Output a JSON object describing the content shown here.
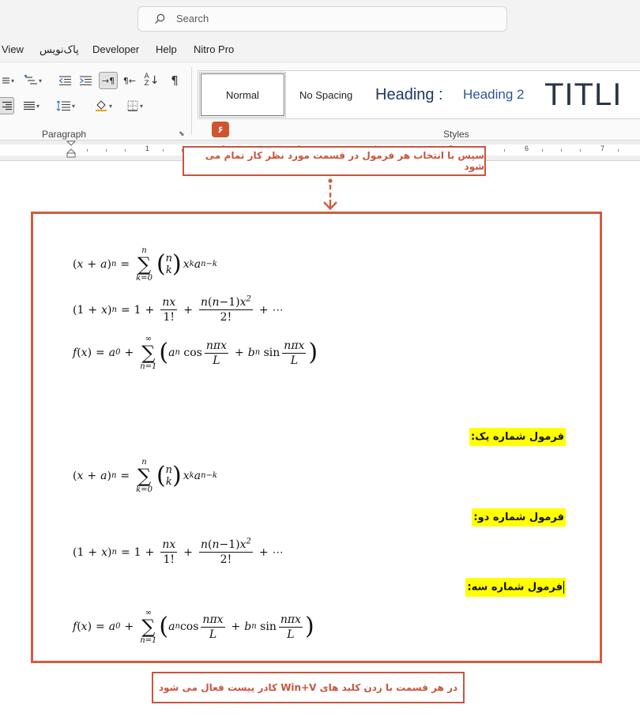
{
  "search": {
    "placeholder": "Search"
  },
  "menu": {
    "items": [
      "View",
      "پاک‌نویس",
      "Developer",
      "Help",
      "Nitro Pro"
    ]
  },
  "ribbon": {
    "paragraph_label": "Paragraph",
    "styles_label": "Styles",
    "styles": [
      "Normal",
      "No Spacing",
      "Heading :",
      "Heading 2",
      "TITLI"
    ],
    "step_badge": "۶"
  },
  "ruler": {
    "numbers": [
      "1",
      "2",
      "3",
      "4",
      "5",
      "6",
      "7"
    ]
  },
  "callouts": {
    "top": "سپس با انتخاب هر فرمول در قسمت مورد نظر کار تمام می شود",
    "bottom": "در هر قسمت با زدن کلید های Win+V کادر پیست فعال می شود"
  },
  "labels": {
    "one": "فرمول شماره یک:",
    "two": "فرمول شماره دو:",
    "three": "فرمول شماره سه:"
  },
  "colors": {
    "accent": "#cf5d3e",
    "highlight": "#ffff00",
    "heading1": "#1f3864",
    "heading2": "#2f5496"
  }
}
